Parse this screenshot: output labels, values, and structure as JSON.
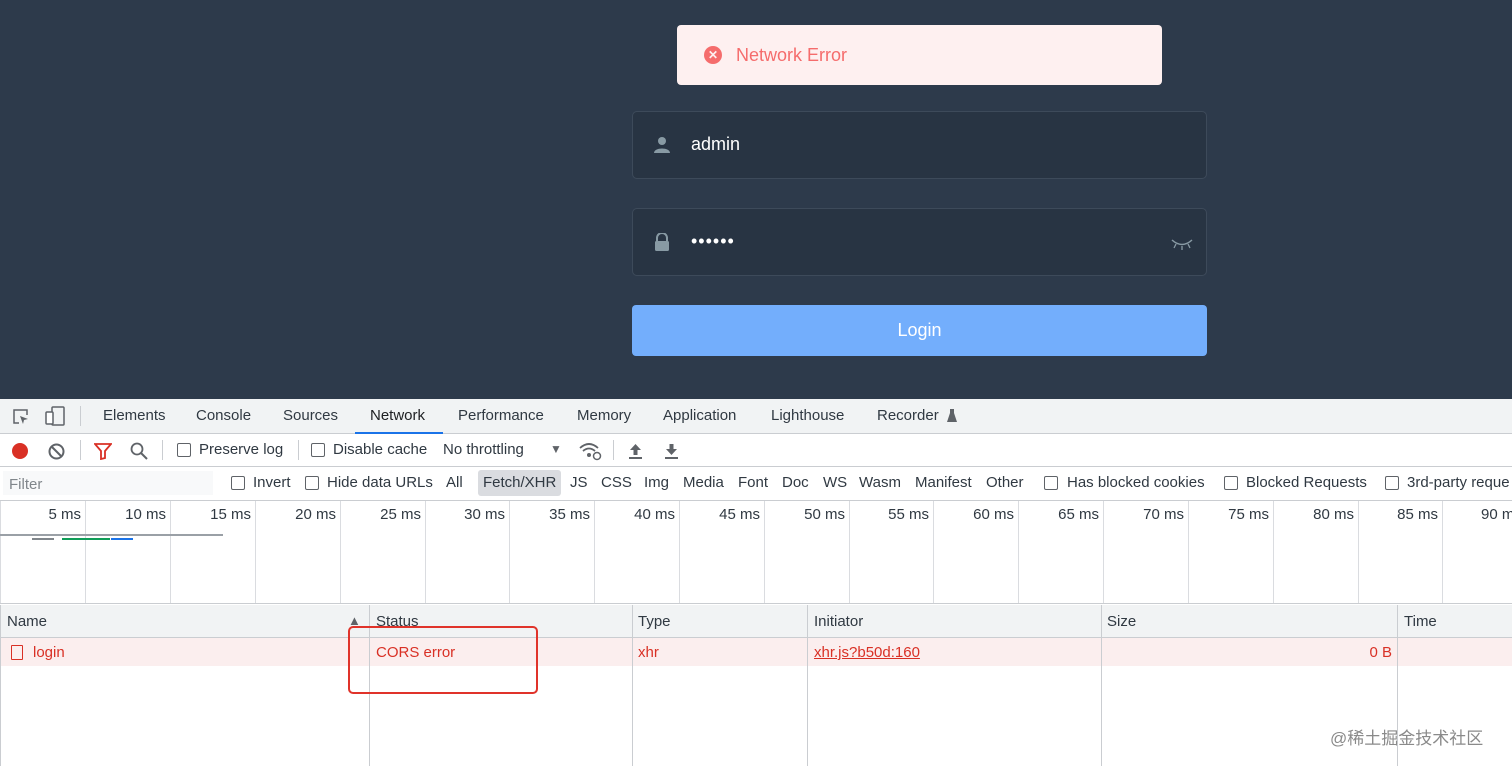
{
  "app": {
    "error_message": "Network Error",
    "username_value": "admin",
    "password_value": "••••••",
    "login_button": "Login",
    "colors": {
      "background": "#2d3a4b",
      "error": "#f56c6c",
      "button": "#73aefc"
    }
  },
  "devtools": {
    "tabs": [
      "Elements",
      "Console",
      "Sources",
      "Network",
      "Performance",
      "Memory",
      "Application",
      "Lighthouse",
      "Recorder"
    ],
    "active_tab": "Network",
    "toolbar": {
      "preserve_log": "Preserve log",
      "disable_cache": "Disable cache",
      "throttling": "No throttling"
    },
    "filter_bar": {
      "placeholder": "Filter",
      "invert": "Invert",
      "hide_data_urls": "Hide data URLs",
      "types": [
        "All",
        "Fetch/XHR",
        "JS",
        "CSS",
        "Img",
        "Media",
        "Font",
        "Doc",
        "WS",
        "Wasm",
        "Manifest",
        "Other"
      ],
      "active_type": "Fetch/XHR",
      "has_blocked_cookies": "Has blocked cookies",
      "blocked_requests": "Blocked Requests",
      "third_party": "3rd-party reque"
    },
    "timeline_ticks": [
      "5 ms",
      "10 ms",
      "15 ms",
      "20 ms",
      "25 ms",
      "30 ms",
      "35 ms",
      "40 ms",
      "45 ms",
      "50 ms",
      "55 ms",
      "60 ms",
      "65 ms",
      "70 ms",
      "75 ms",
      "80 ms",
      "85 ms",
      "90 m"
    ],
    "columns": [
      "Name",
      "Status",
      "Type",
      "Initiator",
      "Size",
      "Time"
    ],
    "requests": [
      {
        "name": "login",
        "status": "CORS error",
        "type": "xhr",
        "initiator": "xhr.js?b50d:160",
        "size": "0 B",
        "time": ""
      }
    ]
  },
  "watermark": "@稀土掘金技术社区"
}
